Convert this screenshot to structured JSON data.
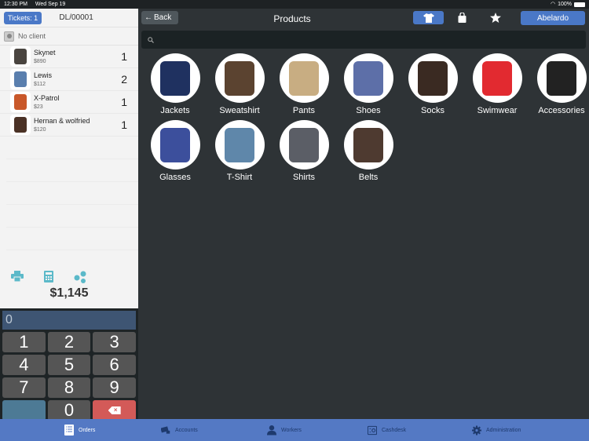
{
  "status_bar": {
    "time": "12:30 PM",
    "date": "Wed Sep 19",
    "battery": "100%"
  },
  "ticket": {
    "tickets_label": "Tickets: 1",
    "ticket_id": "DL/00001",
    "client_label": "No client",
    "items": [
      {
        "name": "Skynet",
        "price": "$890",
        "qty": "1",
        "icon": "leather-jacket-thumb",
        "color": "#4a4540"
      },
      {
        "name": "Lewis",
        "price": "$112",
        "qty": "2",
        "icon": "jeans-thumb",
        "color": "#5a7fae"
      },
      {
        "name": "X-Patrol",
        "price": "$23",
        "qty": "1",
        "icon": "tshirt-thumb",
        "color": "#c9582a"
      },
      {
        "name": "Hernan & wolfried",
        "price": "$120",
        "qty": "1",
        "icon": "belt-thumb",
        "color": "#4b3226"
      }
    ],
    "total": "$1,145",
    "actions": [
      {
        "name": "print-icon",
        "glyph": "🖶"
      },
      {
        "name": "calculator-icon",
        "glyph": "▦"
      },
      {
        "name": "share-icon",
        "glyph": "⁂"
      }
    ]
  },
  "keypad": {
    "display_value": "0",
    "keys": [
      "1",
      "2",
      "3",
      "4",
      "5",
      "6",
      "7",
      "8",
      "9",
      "",
      "0",
      "×"
    ]
  },
  "header": {
    "back_label": "Back",
    "title": "Products",
    "user_label": "Abelardo",
    "search_placeholder": ""
  },
  "categories": [
    {
      "label": "Jackets",
      "color": "#1f3160"
    },
    {
      "label": "Sweatshirt",
      "color": "#5b4330"
    },
    {
      "label": "Pants",
      "color": "#c8ad82"
    },
    {
      "label": "Shoes",
      "color": "#5d6fa8"
    },
    {
      "label": "Socks",
      "color": "#3a2a22"
    },
    {
      "label": "Swimwear",
      "color": "#e22a30"
    },
    {
      "label": "Accessories",
      "color": "#222222"
    },
    {
      "label": "Glasses",
      "color": "#3c4f9c"
    },
    {
      "label": "T-Shirt",
      "color": "#5f87aa"
    },
    {
      "label": "Shirts",
      "color": "#5b5e66"
    },
    {
      "label": "Belts",
      "color": "#4e3a30"
    }
  ],
  "tabs": [
    {
      "label": "Orders",
      "active": true
    },
    {
      "label": "Accounts",
      "active": false
    },
    {
      "label": "Workers",
      "active": false
    },
    {
      "label": "Cashdesk",
      "active": false
    },
    {
      "label": "Administration",
      "active": false
    }
  ],
  "colors": {
    "accent": "#4a78c7",
    "tabbar": "#5479c4",
    "delete": "#d35a58",
    "action": "#5bb9c9"
  }
}
